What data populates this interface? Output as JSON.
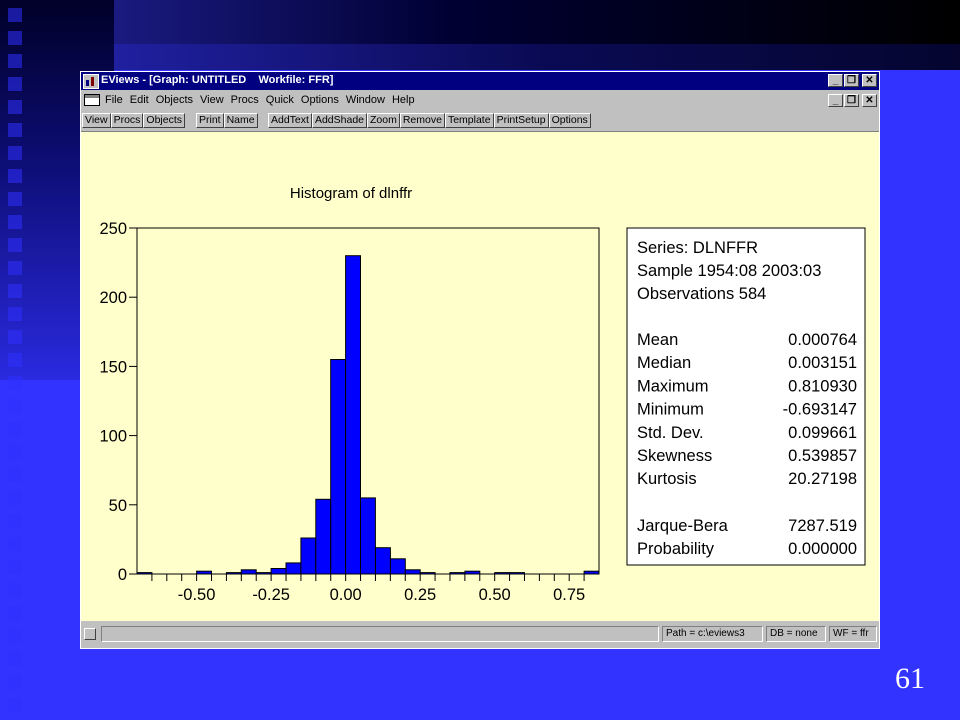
{
  "window": {
    "title": "EViews - [Graph: UNTITLED    Workfile: FFR]"
  },
  "menu": [
    {
      "label": "File"
    },
    {
      "label": "Edit"
    },
    {
      "label": "Objects"
    },
    {
      "label": "View"
    },
    {
      "label": "Procs"
    },
    {
      "label": "Quick"
    },
    {
      "label": "Options"
    },
    {
      "label": "Window"
    },
    {
      "label": "Help"
    }
  ],
  "toolbar": {
    "group1": [
      "View",
      "Procs",
      "Objects"
    ],
    "group2": [
      "Print",
      "Name"
    ],
    "group3": [
      "AddText",
      "AddShade",
      "Zoom",
      "Remove",
      "Template",
      "PrintSetup",
      "Options"
    ]
  },
  "status": {
    "path": "Path = c:\\eviews3",
    "db": "DB = none",
    "wf": "WF = ffr"
  },
  "slide": {
    "page_number": "61"
  },
  "stats": {
    "series": "Series: DLNFFR",
    "sample": "Sample 1954:08 2003:03",
    "observations": "Observations 584",
    "rows1": [
      {
        "label": "Mean",
        "value": "0.000764"
      },
      {
        "label": "Median",
        "value": "0.003151"
      },
      {
        "label": "Maximum",
        "value": "0.810930"
      },
      {
        "label": "Minimum",
        "value": "-0.693147"
      },
      {
        "label": "Std. Dev.",
        "value": "0.099661"
      },
      {
        "label": "Skewness",
        "value": "0.539857"
      },
      {
        "label": "Kurtosis",
        "value": "20.27198"
      }
    ],
    "rows2": [
      {
        "label": "Jarque-Bera",
        "value": "7287.519"
      },
      {
        "label": "Probability",
        "value": "0.000000"
      }
    ]
  },
  "chart_data": {
    "type": "bar",
    "title": "Histogram of dlnffr",
    "xlabel": "",
    "ylabel": "",
    "bin_width": 0.05,
    "bin_starts": [
      -0.7,
      -0.65,
      -0.6,
      -0.55,
      -0.5,
      -0.45,
      -0.4,
      -0.35,
      -0.3,
      -0.25,
      -0.2,
      -0.15,
      -0.1,
      -0.05,
      0.0,
      0.05,
      0.1,
      0.15,
      0.2,
      0.25,
      0.3,
      0.35,
      0.4,
      0.45,
      0.5,
      0.55,
      0.6,
      0.65,
      0.7,
      0.75,
      0.8
    ],
    "values": [
      1,
      0,
      0,
      0,
      2,
      0,
      1,
      3,
      1,
      4,
      8,
      26,
      54,
      155,
      230,
      55,
      19,
      11,
      3,
      1,
      0,
      1,
      2,
      0,
      1,
      1,
      0,
      0,
      0,
      0,
      2
    ],
    "xlim": [
      -0.7,
      0.85
    ],
    "ylim": [
      0,
      250
    ],
    "xticks": [
      -0.5,
      -0.25,
      0.0,
      0.25,
      0.5,
      0.75
    ],
    "xtick_labels": [
      "-0.50",
      "-0.25",
      "0.00",
      "0.25",
      "0.50",
      "0.75"
    ],
    "yticks": [
      0,
      50,
      100,
      150,
      200,
      250
    ],
    "ytick_labels": [
      "0",
      "50",
      "100",
      "150",
      "200",
      "250"
    ],
    "bar_color": "#0000ff",
    "background": "#ffffcc",
    "grid": false
  }
}
